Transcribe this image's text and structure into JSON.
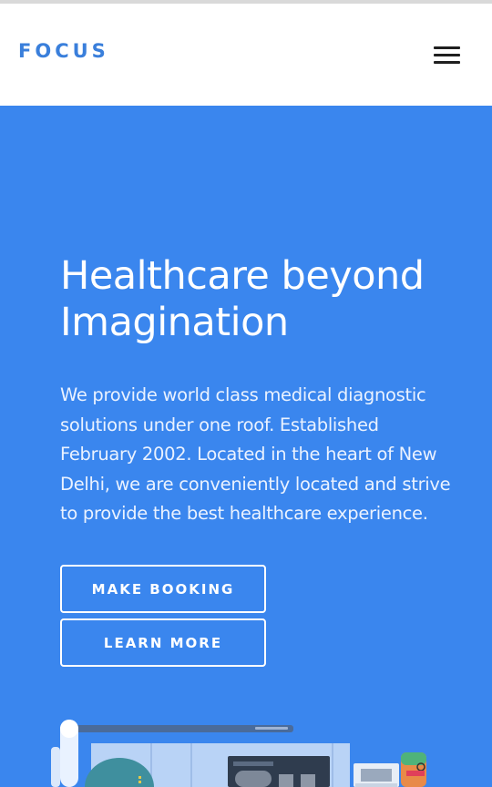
{
  "header": {
    "logo": "FOCUS",
    "menu_icon": "hamburger-menu-icon"
  },
  "hero": {
    "headline_line1": "Healthcare beyond",
    "headline_line2": "Imagination",
    "description_lines": [
      "We provide world class medical diagnostic",
      "solutions under one roof. Established",
      "February 2002. Located in the heart of New",
      "Delhi, we are conveniently located and strive",
      "to provide the best healthcare experience."
    ],
    "buttons": {
      "make_booking": "MAKE BOOKING",
      "learn_more": "LEARN MORE"
    }
  },
  "colors": {
    "brand_blue": "#3a7fdb",
    "hero_background": "#3a86ee",
    "text_on_hero": "#ffffff"
  }
}
